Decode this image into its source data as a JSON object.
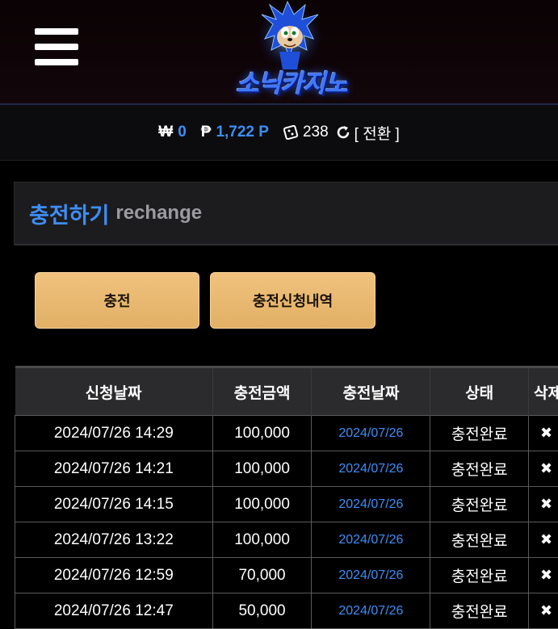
{
  "header": {
    "logo_text": "소닉카지노",
    "menu_icon": "hamburger-icon"
  },
  "balance": {
    "won_symbol": "₩",
    "won_value": "0",
    "point_symbol": "₱",
    "point_value": "1,722 P",
    "chip_icon": "chip-icon",
    "chip_value": "238",
    "refresh_icon": "refresh-icon",
    "exchange_label": "[ 전환 ]"
  },
  "page": {
    "title": "충전하기",
    "subtitle": "rechange"
  },
  "buttons": {
    "charge": "충전",
    "history": "충전신청내역"
  },
  "colors": {
    "accent": "#3e8ef7",
    "button": "#e8b76f",
    "background": "#000000"
  },
  "table": {
    "headers": [
      "신청날짜",
      "충전금액",
      "충전날짜",
      "상태",
      "삭제"
    ],
    "rows": [
      {
        "requested": "2024/07/26 14:29",
        "amount": "100,000",
        "charged": "2024/07/26",
        "status": "충전완료",
        "delete": "✖"
      },
      {
        "requested": "2024/07/26 14:21",
        "amount": "100,000",
        "charged": "2024/07/26",
        "status": "충전완료",
        "delete": "✖"
      },
      {
        "requested": "2024/07/26 14:15",
        "amount": "100,000",
        "charged": "2024/07/26",
        "status": "충전완료",
        "delete": "✖"
      },
      {
        "requested": "2024/07/26 13:22",
        "amount": "100,000",
        "charged": "2024/07/26",
        "status": "충전완료",
        "delete": "✖"
      },
      {
        "requested": "2024/07/26 12:59",
        "amount": "70,000",
        "charged": "2024/07/26",
        "status": "충전완료",
        "delete": "✖"
      },
      {
        "requested": "2024/07/26 12:47",
        "amount": "50,000",
        "charged": "2024/07/26",
        "status": "충전완료",
        "delete": "✖"
      }
    ]
  }
}
